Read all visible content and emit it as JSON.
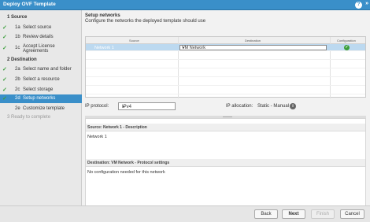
{
  "window": {
    "title": "Deploy OVF Template"
  },
  "sidebar": {
    "sections": [
      {
        "label": "1 Source"
      },
      {
        "label": "2 Destination"
      }
    ],
    "steps": [
      {
        "num": "1a",
        "label": "Select source",
        "state": "done"
      },
      {
        "num": "1b",
        "label": "Review details",
        "state": "done"
      },
      {
        "num": "1c",
        "label": "Accept License Agreements",
        "state": "done"
      },
      {
        "num": "2a",
        "label": "Select name and folder",
        "state": "done"
      },
      {
        "num": "2b",
        "label": "Select a resource",
        "state": "done"
      },
      {
        "num": "2c",
        "label": "Select storage",
        "state": "done"
      },
      {
        "num": "2d",
        "label": "Setup networks",
        "state": "active"
      },
      {
        "num": "2e",
        "label": "Customize template",
        "state": "pending"
      },
      {
        "num": "3",
        "label": "Ready to complete",
        "state": "disabled"
      }
    ]
  },
  "main": {
    "title": "Setup networks",
    "subtitle": "Configure the networks the deployed template should use",
    "table": {
      "columns": [
        "Source",
        "Destination",
        "Configuration"
      ],
      "rows": [
        {
          "source": "Network 1",
          "destination": "VM Network",
          "status": "ok"
        }
      ]
    },
    "ip_protocol_label": "IP protocol:",
    "ip_protocol_value": "IPv4",
    "ip_allocation_label": "IP allocation:",
    "ip_allocation_value": "Static - Manual",
    "desc_title": "Source: Network 1 - Description",
    "desc_text": "Network 1",
    "dest_title": "Destination: VM Network - Protocol settings",
    "dest_text": "No configuration needed for this network"
  },
  "footer": {
    "back": "Back",
    "next": "Next",
    "finish": "Finish",
    "cancel": "Cancel"
  },
  "colors": {
    "accent": "#3a8fc9",
    "success": "#3a9e3a",
    "selection": "#bcd9f0"
  }
}
